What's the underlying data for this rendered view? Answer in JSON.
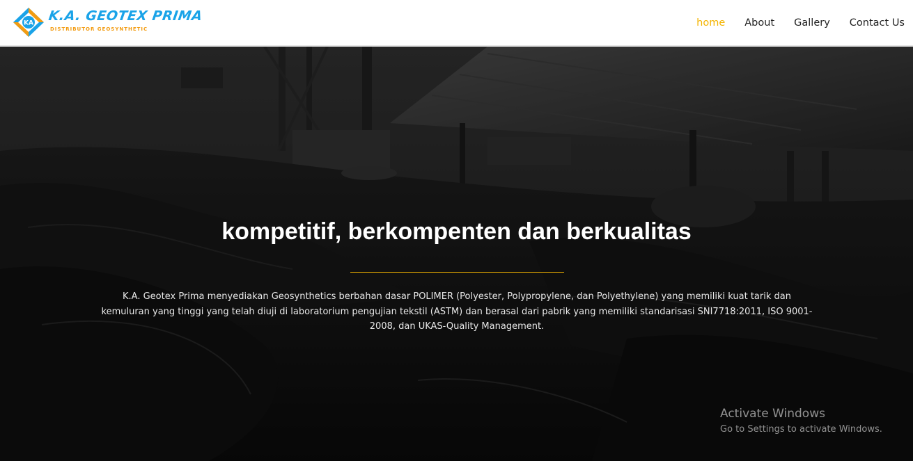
{
  "brand": {
    "title": "K.A. GEOTEX PRIMA",
    "subtitle": "DISTRIBUTOR GEOSYNTHETIC",
    "mark_text": "KA",
    "colors": {
      "blue": "#1aa3e8",
      "orange": "#f39c12"
    }
  },
  "nav": {
    "items": [
      {
        "label": "home",
        "active": true
      },
      {
        "label": "About",
        "active": false
      },
      {
        "label": "Gallery",
        "active": false
      },
      {
        "label": "Contact Us",
        "active": false
      }
    ],
    "active_color": "#f4b400"
  },
  "hero": {
    "title": "kompetitif, berkompenten dan berkualitas",
    "description": "K.A. Geotex Prima menyediakan Geosynthetics berbahan dasar POLIMER (Polyester, Polypropylene, dan Polyethylene) yang memiliki kuat tarik dan kemuluran yang tinggi yang telah diuji di laboratorium pengujian tekstil (ASTM) dan berasal dari pabrik yang memiliki standarisasi SNI7718:2011, ISO 9001-2008, dan UKAS-Quality Management.",
    "rule_color": "#f4b400"
  },
  "watermark": {
    "title": "Activate Windows",
    "subtitle": "Go to Settings to activate Windows."
  }
}
